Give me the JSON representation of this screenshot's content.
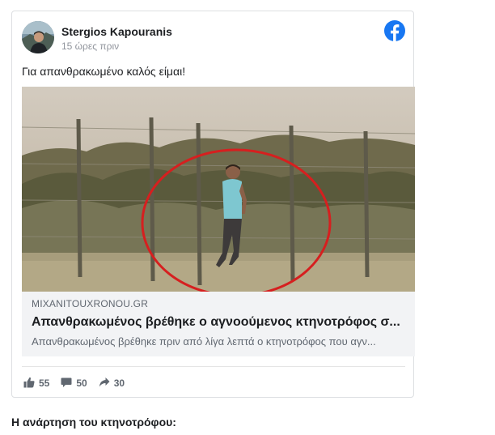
{
  "post": {
    "author": "Stergios Kapouranis",
    "time": "15 ώρες πριν",
    "text": "Για απανθρακωμένο καλός είμαι!",
    "brand_color": "#1877f2"
  },
  "link_preview": {
    "domain": "MIXANITOUXRONOU.GR",
    "title": "Απανθρακωμένος βρέθηκε ο αγνοούμενος κτηνοτρόφος σ...",
    "description": "Απανθρακωμένος βρέθηκε πριν από λίγα λεπτά ο κτηνοτρόφος που αγν..."
  },
  "stats": {
    "likes": "55",
    "comments": "50",
    "shares": "30"
  },
  "icons": {
    "platform": "facebook-icon",
    "like": "thumbs-up-icon",
    "comment": "comment-icon",
    "share": "share-icon"
  },
  "caption": "Η ανάρτηση του κτηνοτρόφου:"
}
